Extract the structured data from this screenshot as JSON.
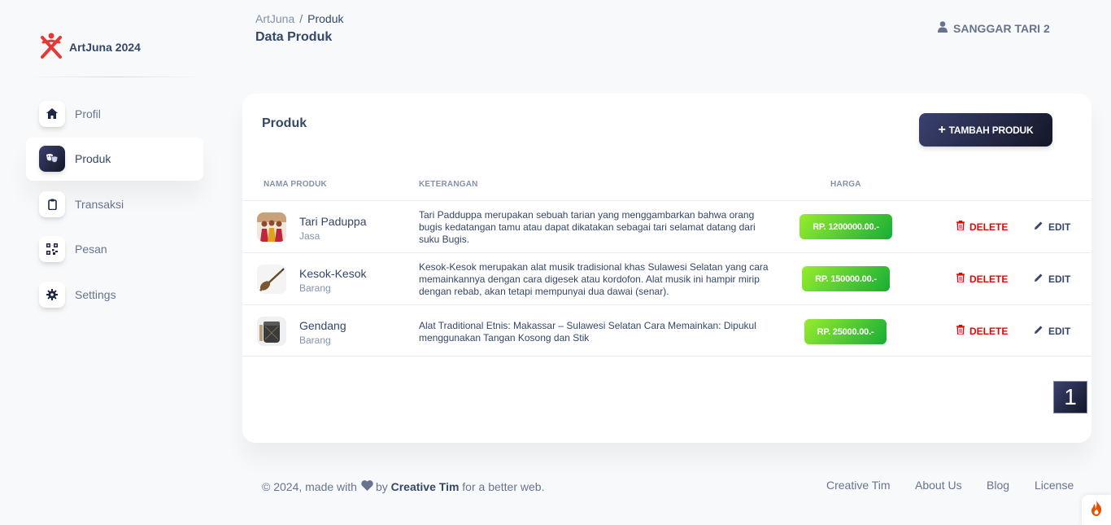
{
  "brand": {
    "name": "ArtJuna 2024"
  },
  "sidebar": {
    "items": [
      {
        "label": "Profil",
        "icon": "home-icon"
      },
      {
        "label": "Produk",
        "icon": "masks-icon",
        "active": true
      },
      {
        "label": "Transaksi",
        "icon": "clipboard-icon"
      },
      {
        "label": "Pesan",
        "icon": "qr-icon"
      },
      {
        "label": "Settings",
        "icon": "gear-icon"
      }
    ]
  },
  "header": {
    "breadcrumb_root": "ArtJuna",
    "breadcrumb_sep": "/",
    "breadcrumb_current": "Produk",
    "title": "Data Produk",
    "user": "SANGGAR TARI 2"
  },
  "card": {
    "title": "Produk",
    "add_button": "TAMBAH PRODUK",
    "columns": [
      "NAMA PRODUK",
      "KETERANGAN",
      "HARGA"
    ],
    "rows": [
      {
        "name": "Tari Paduppa",
        "type": "Jasa",
        "description": "Tari Padduppa merupakan sebuah tarian yang menggambarkan bahwa orang bugis kedatangan tamu atau dapat dikatakan sebagai tari selamat datang dari suku Bugis.",
        "price": "RP. 1200000.00.-"
      },
      {
        "name": "Kesok-Kesok",
        "type": "Barang",
        "description": "Kesok-Kesok merupakan alat musik tradisional khas Sulawesi Selatan yang cara memainkannya dengan cara digesek atau kordofon. Alat musik ini hampir mirip dengan rebab, akan tetapi mempunyai dua dawai (senar).",
        "price": "RP. 150000.00.-"
      },
      {
        "name": "Gendang",
        "type": "Barang",
        "description": "Alat Traditional Etnis: Makassar – Sulawesi Selatan Cara Memainkan: Dipukul menggunakan Tangan Kosong dan Stik",
        "price": "RP. 25000.00.-"
      }
    ],
    "delete_label": "DELETE",
    "edit_label": "EDIT",
    "page": "1"
  },
  "footer": {
    "copy_prefix": "© 2024, made with",
    "copy_by": "by",
    "author": "Creative Tim",
    "copy_suffix": "for a better web.",
    "links": [
      "Creative Tim",
      "About Us",
      "Blog",
      "License"
    ]
  },
  "colors": {
    "accent_dark": "#344767",
    "gradient_dark_start": "#141727",
    "gradient_dark_end": "#3a416f",
    "success_start": "#17ad37",
    "success_end": "#98ec2d",
    "danger": "#ea0606",
    "brand_red": "#e53935"
  }
}
